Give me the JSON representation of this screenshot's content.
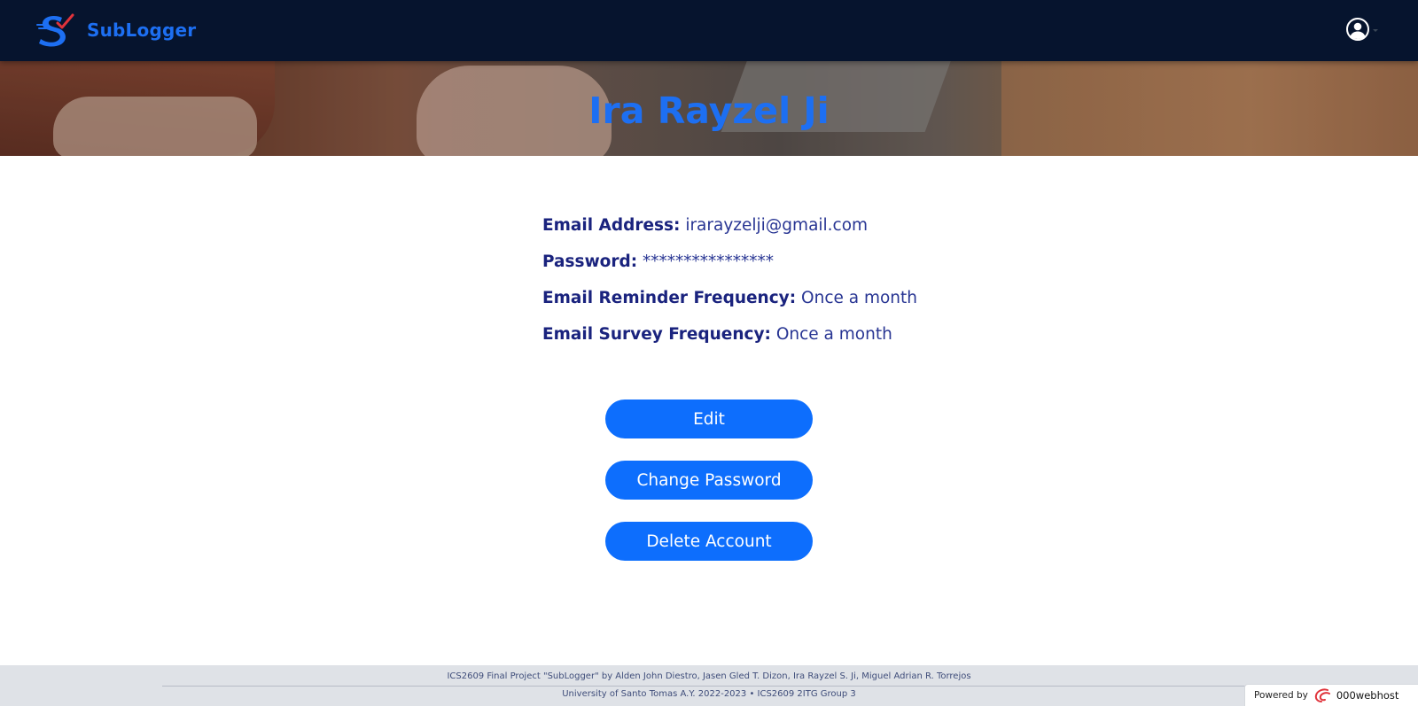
{
  "header": {
    "brand_name": "SubLogger",
    "logo_icon": "sublogger-logo-icon",
    "profile_icon": "user-circle-icon",
    "colors": {
      "background": "#06142e",
      "brand": "#1d6ff2"
    }
  },
  "profile": {
    "name": "Ira Rayzel Ji",
    "fields": [
      {
        "label": "Email Address:",
        "value": "irarayzelji@gmail.com"
      },
      {
        "label": "Password:",
        "value": "****************"
      },
      {
        "label": "Email Reminder Frequency:",
        "value": "Once a month"
      },
      {
        "label": "Email Survey Frequency:",
        "value": "Once a month"
      }
    ]
  },
  "actions": {
    "edit": "Edit",
    "change_password": "Change Password",
    "delete_account": "Delete Account",
    "button_color": "#0d6efd"
  },
  "footer": {
    "line1": "ICS2609 Final Project \"SubLogger\" by Alden John Diestro, Jasen Gled T. Dizon, Ira Rayzel S. Ji, Miguel Adrian R. Torrejos",
    "line2": "University of Santo Tomas A.Y. 2022-2023 • ICS2609 2ITG Group 3"
  },
  "badge": {
    "label": "Powered by",
    "host": "000webhost",
    "host_icon": "000webhost-logo-icon"
  }
}
